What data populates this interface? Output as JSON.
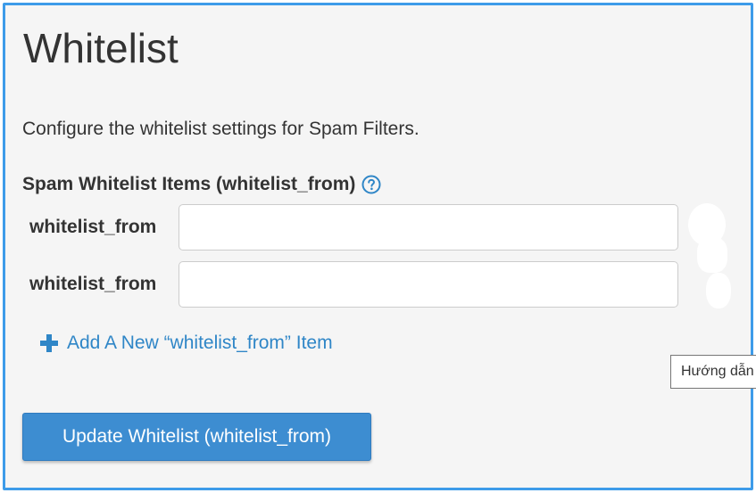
{
  "page": {
    "title": "Whitelist",
    "description": "Configure the whitelist settings for Spam Filters."
  },
  "section": {
    "label": "Spam Whitelist Items (whitelist_from)",
    "help_icon": "question-circle-icon"
  },
  "rows": [
    {
      "label": "whitelist_from",
      "value": "",
      "placeholder": ""
    },
    {
      "label": "whitelist_from",
      "value": "",
      "placeholder": ""
    }
  ],
  "add_item": {
    "icon": "plus-icon",
    "label": "Add A New “whitelist_from” Item"
  },
  "update_button": {
    "label": "Update Whitelist (whitelist_from)"
  },
  "tooltip": {
    "text": "Hướng dẫn"
  },
  "colors": {
    "frame_border": "#3d9be9",
    "link": "#2f86c7",
    "button_bg": "#3d8dd1",
    "text": "#333333"
  }
}
